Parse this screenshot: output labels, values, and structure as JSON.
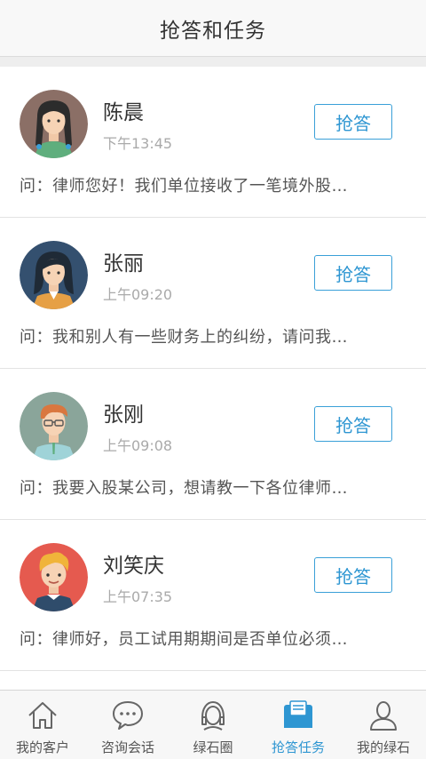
{
  "header": {
    "title": "抢答和任务"
  },
  "items": [
    {
      "name": "陈晨",
      "time": "下午13:45",
      "button": "抢答",
      "question": "问：律师您好！我们单位接收了一笔境外股…"
    },
    {
      "name": "张丽",
      "time": "上午09:20",
      "button": "抢答",
      "question": "问：我和别人有一些财务上的纠纷，请问我…"
    },
    {
      "name": "张刚",
      "time": "上午09:08",
      "button": "抢答",
      "question": "问：我要入股某公司，想请教一下各位律师…"
    },
    {
      "name": "刘笑庆",
      "time": "上午07:35",
      "button": "抢答",
      "question": "问：律师好，员工试用期期间是否单位必须…"
    }
  ],
  "tabs": [
    {
      "label": "我的客户",
      "icon": "home-icon",
      "active": false
    },
    {
      "label": "咨询会话",
      "icon": "chat-bubble-icon",
      "active": false
    },
    {
      "label": "绿石圈",
      "icon": "headset-icon",
      "active": false
    },
    {
      "label": "抢答任务",
      "icon": "task-envelope-icon",
      "active": true
    },
    {
      "label": "我的绿石",
      "icon": "user-icon",
      "active": false
    }
  ],
  "colors": {
    "accent": "#2e96d2",
    "border": "#e3e3e3",
    "text": "#333333"
  }
}
